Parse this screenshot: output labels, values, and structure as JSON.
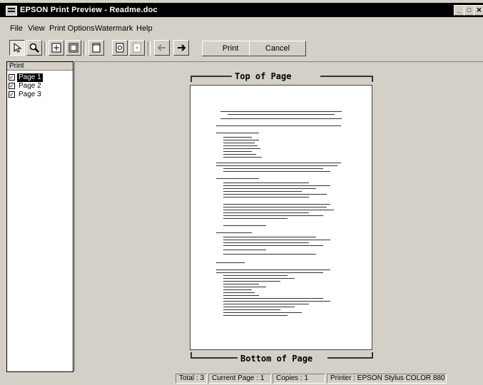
{
  "window": {
    "title": "EPSON Print Preview - Readme.doc",
    "controls": {
      "minimize": "_",
      "maximize": "□",
      "close": "✕"
    }
  },
  "menu": [
    "File",
    "View",
    "Print Options",
    "Watermark",
    "Help"
  ],
  "toolbar": {
    "icons": [
      "arrow-pointer-icon",
      "magnifier-icon",
      "fit-page-icon",
      "scale-icon",
      "margins-icon",
      "watermark-icon",
      "add-icon",
      "back-arrow-icon",
      "forward-arrow-icon"
    ],
    "print_label": "Print",
    "cancel_label": "Cancel"
  },
  "page_list": {
    "header": "Print",
    "pages": [
      {
        "label": "Page 1",
        "checked": true,
        "selected": true
      },
      {
        "label": "Page 2",
        "checked": true,
        "selected": false
      },
      {
        "label": "Page 3",
        "checked": true,
        "selected": false
      }
    ]
  },
  "preview": {
    "top_label": "Top of Page",
    "bottom_label": "Bottom of Page"
  },
  "status": {
    "total": "Total : 3",
    "current_page": "Current Page : 1",
    "copies": "Copies : 1",
    "printer": "Printer : EPSON Stylus COLOR 880"
  }
}
